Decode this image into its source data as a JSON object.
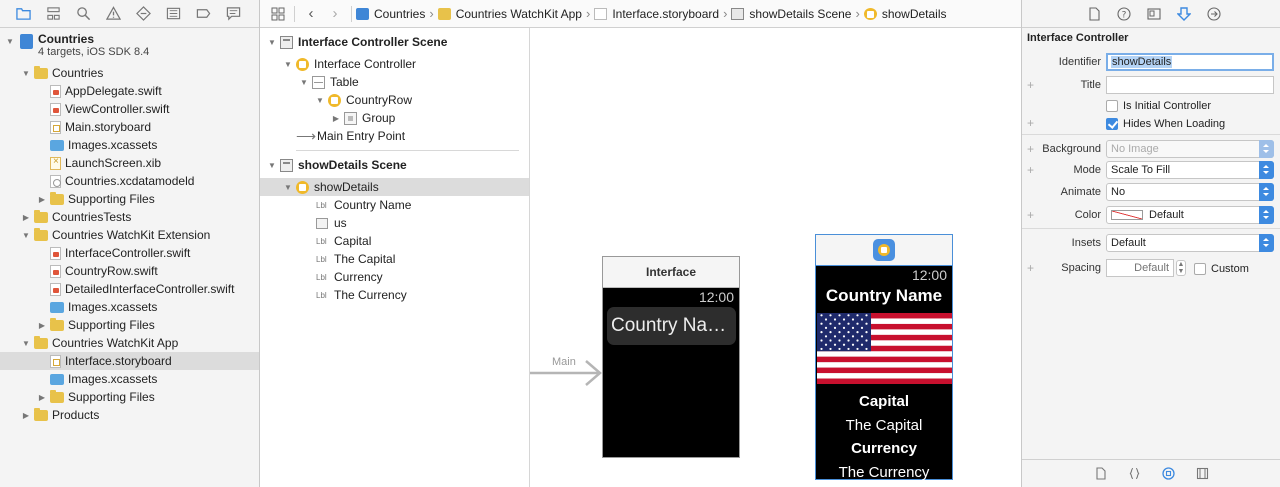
{
  "navigator": {
    "project": {
      "name": "Countries",
      "subtitle": "4 targets, iOS SDK 8.4"
    },
    "items": [
      {
        "label": "Countries",
        "depth": 1,
        "icon": "folder",
        "disclosure": "open"
      },
      {
        "label": "AppDelegate.swift",
        "depth": 2,
        "icon": "swift-file"
      },
      {
        "label": "ViewController.swift",
        "depth": 2,
        "icon": "swift-file"
      },
      {
        "label": "Main.storyboard",
        "depth": 2,
        "icon": "storyboard-file"
      },
      {
        "label": "Images.xcassets",
        "depth": 2,
        "icon": "asset-catalog"
      },
      {
        "label": "LaunchScreen.xib",
        "depth": 2,
        "icon": "xib-file"
      },
      {
        "label": "Countries.xcdatamodeld",
        "depth": 2,
        "icon": "data-model-file"
      },
      {
        "label": "Supporting Files",
        "depth": 2,
        "icon": "folder",
        "disclosure": "closed"
      },
      {
        "label": "CountriesTests",
        "depth": 1,
        "icon": "folder",
        "disclosure": "closed"
      },
      {
        "label": "Countries WatchKit Extension",
        "depth": 1,
        "icon": "folder",
        "disclosure": "open"
      },
      {
        "label": "InterfaceController.swift",
        "depth": 2,
        "icon": "swift-file"
      },
      {
        "label": "CountryRow.swift",
        "depth": 2,
        "icon": "swift-file"
      },
      {
        "label": "DetailedInterfaceController.swift",
        "depth": 2,
        "icon": "swift-file"
      },
      {
        "label": "Images.xcassets",
        "depth": 2,
        "icon": "asset-catalog"
      },
      {
        "label": "Supporting Files",
        "depth": 2,
        "icon": "folder",
        "disclosure": "closed"
      },
      {
        "label": "Countries WatchKit App",
        "depth": 1,
        "icon": "folder",
        "disclosure": "open"
      },
      {
        "label": "Interface.storyboard",
        "depth": 2,
        "icon": "storyboard-file",
        "selected": true
      },
      {
        "label": "Images.xcassets",
        "depth": 2,
        "icon": "asset-catalog"
      },
      {
        "label": "Supporting Files",
        "depth": 2,
        "icon": "folder",
        "disclosure": "closed"
      },
      {
        "label": "Products",
        "depth": 1,
        "icon": "folder",
        "disclosure": "closed"
      }
    ]
  },
  "jumpbar": {
    "crumbs": [
      "Countries",
      "Countries WatchKit App",
      "Interface.storyboard",
      "showDetails Scene",
      "showDetails"
    ]
  },
  "outline": {
    "scene1": {
      "title": "Interface Controller Scene",
      "controller": "Interface Controller",
      "table": "Table",
      "row": "CountryRow",
      "group": "Group",
      "entry": "Main Entry Point"
    },
    "scene2": {
      "title": "showDetails Scene",
      "controller": "showDetails",
      "lbl_tag": "Lbl",
      "items": [
        {
          "label": "Country Name",
          "kind": "label"
        },
        {
          "label": "us",
          "kind": "image"
        },
        {
          "label": "Capital",
          "kind": "label"
        },
        {
          "label": "The Capital",
          "kind": "label"
        },
        {
          "label": "Currency",
          "kind": "label"
        },
        {
          "label": "The Currency",
          "kind": "label"
        }
      ]
    }
  },
  "canvas": {
    "entry_label": "Main",
    "interface": {
      "title": "Interface",
      "time": "12:00",
      "row_text": "Country Na…"
    },
    "details": {
      "time": "12:00",
      "country": "Country Name",
      "capital_label": "Capital",
      "capital_value": "The Capital",
      "currency_label": "Currency",
      "currency_value": "The Currency"
    }
  },
  "inspector": {
    "section_title": "Interface Controller",
    "identifier_label": "Identifier",
    "identifier_value": "showDetails",
    "title_label": "Title",
    "title_value": "",
    "initial_label": "Is Initial Controller",
    "initial_checked": false,
    "hides_label": "Hides When Loading",
    "hides_checked": true,
    "background_label": "Background",
    "background_placeholder": "No Image",
    "mode_label": "Mode",
    "mode_value": "Scale To Fill",
    "animate_label": "Animate",
    "animate_value": "No",
    "color_label": "Color",
    "color_value": "Default",
    "insets_label": "Insets",
    "insets_value": "Default",
    "spacing_label": "Spacing",
    "spacing_placeholder": "Default",
    "custom_label": "Custom",
    "plus": "+"
  },
  "colors": {
    "accent": "#3d8ae0",
    "folder": "#e8c24a",
    "selection": "#dcdcdc"
  }
}
